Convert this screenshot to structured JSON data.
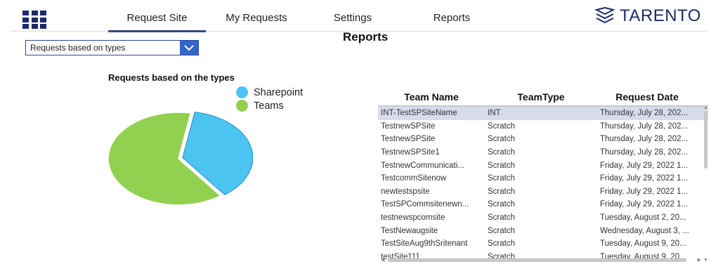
{
  "nav": {
    "tabs": [
      {
        "label": "Request Site",
        "active": true
      },
      {
        "label": "My Requests",
        "active": false
      },
      {
        "label": "Settings",
        "active": false
      },
      {
        "label": "Reports",
        "active": false
      }
    ],
    "logo_text": "TARENTO"
  },
  "page": {
    "title": "Reports"
  },
  "filter": {
    "selected": "Requests based on types"
  },
  "chart_data": {
    "type": "pie",
    "title": "Requests based on the types",
    "labels": [
      "Sharepoint",
      "Teams"
    ],
    "values": [
      37,
      63
    ],
    "colors": [
      "#4cc4f2",
      "#92d050"
    ]
  },
  "table": {
    "columns": [
      "Team Name",
      "TeamType",
      "Request Date"
    ],
    "rows": [
      [
        "INT-TestSPSiteName",
        "INT",
        "Thursday, July 28, 202..."
      ],
      [
        "TestnewSPSite",
        "Scratch",
        "Thursday, July 28, 202..."
      ],
      [
        "TestnewSPSite",
        "Scratch",
        "Thursday, July 28, 202..."
      ],
      [
        "TestnewSPSite1",
        "Scratch",
        "Thursday, July 28, 202..."
      ],
      [
        "TestnewCommunicati...",
        "Scratch",
        "Friday, July 29, 2022 1..."
      ],
      [
        "TestcommSitenow",
        "Scratch",
        "Friday, July 29, 2022 1..."
      ],
      [
        "newtestspsite",
        "Scratch",
        "Friday, July 29, 2022 1..."
      ],
      [
        "TestSPCommsitenewn...",
        "Scratch",
        "Friday, July 29, 2022 1..."
      ],
      [
        "testnewspcomsite",
        "Scratch",
        "Tuesday, August 2, 20..."
      ],
      [
        "TestNewaugsite",
        "Scratch",
        "Wednesday, August 3, ..."
      ],
      [
        "TestSiteAug9thSritenant",
        "Scratch",
        "Tuesday, August 9, 20..."
      ],
      [
        "testSite111",
        "Scratch",
        "Tuesday, August 9, 20..."
      ]
    ]
  },
  "colors": {
    "accent": "#2e4a8f",
    "brand": "#1b2a6b",
    "selected_row": "#d6dcec"
  }
}
